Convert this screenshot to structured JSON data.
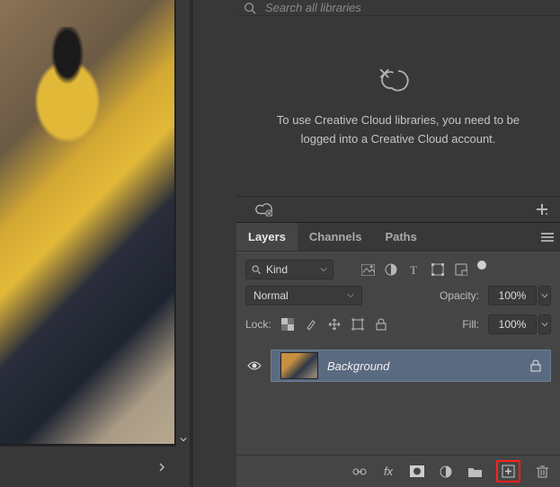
{
  "libraries": {
    "search_placeholder": "Search all libraries",
    "message": "To use Creative Cloud libraries, you need to be logged into a Creative Cloud account."
  },
  "layers_panel": {
    "tabs": [
      {
        "label": "Layers",
        "active": true
      },
      {
        "label": "Channels",
        "active": false
      },
      {
        "label": "Paths",
        "active": false
      }
    ],
    "filter": {
      "kind_label": "Kind"
    },
    "blend": {
      "mode": "Normal",
      "opacity_label": "Opacity:",
      "opacity_value": "100%"
    },
    "lock_row": {
      "label": "Lock:",
      "fill_label": "Fill:",
      "fill_value": "100%"
    },
    "layers": [
      {
        "name": "Background",
        "visible": true,
        "locked": true
      }
    ]
  }
}
